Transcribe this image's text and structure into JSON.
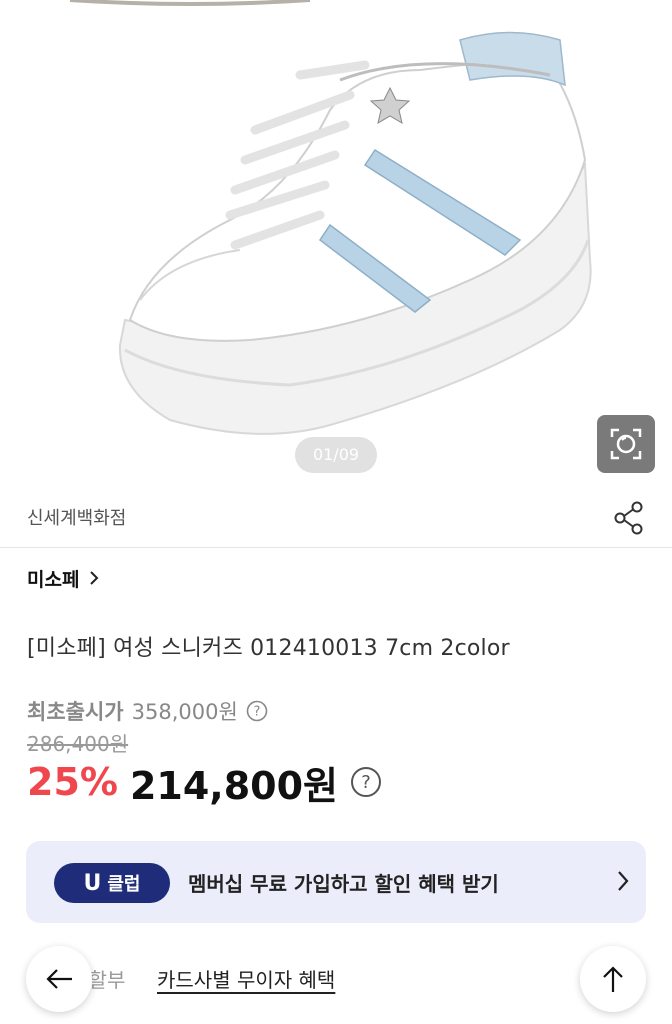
{
  "gallery": {
    "counter": "01/09",
    "lens_icon": "camera-search-icon"
  },
  "store": {
    "name": "신세계백화점",
    "share_icon": "share-icon"
  },
  "brand": {
    "name": "미소페",
    "chevron_icon": "chevron-right-icon"
  },
  "product": {
    "title": "[미소페] 여성 스니커즈 012410013 7cm 2color"
  },
  "price": {
    "original_label": "최초출시가",
    "original_price": "358,000원",
    "strike_price": "286,400원",
    "discount": "25%",
    "sale_price": "214,800원",
    "help_icon": "question-circle-icon"
  },
  "uclub": {
    "badge_u": "U",
    "badge_text": "클럽",
    "text": "멤버십 무료 가입하고 할인 혜택 받기",
    "colors": {
      "background": "#ecedfb",
      "badge": "#1f2c7a"
    }
  },
  "installment": {
    "label": "무이자 할부",
    "link": "카드사별 무이자 혜택"
  },
  "nav": {
    "back_icon": "arrow-left-icon",
    "top_icon": "arrow-up-icon"
  },
  "colors": {
    "discount": "#f0474f",
    "text": "#111111",
    "muted": "#888888"
  }
}
